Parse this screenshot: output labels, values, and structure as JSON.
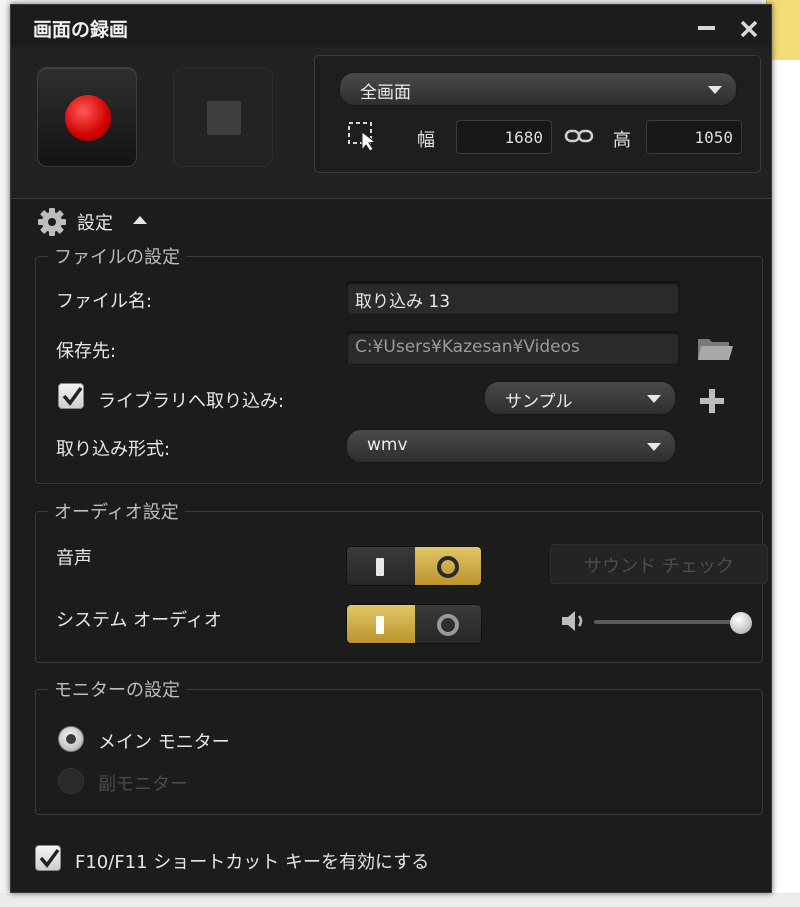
{
  "window": {
    "title": "画面の録画"
  },
  "capture": {
    "mode_selected": "全画面",
    "width_label": "幅",
    "width_value": "1680",
    "height_label": "高",
    "height_value": "1050"
  },
  "settings": {
    "header_label": "設定",
    "file_group": {
      "title": "ファイルの設定",
      "filename_label": "ファイル名:",
      "filename_value": "取り込み 13",
      "save_label": "保存先:",
      "save_value": "C:¥Users¥Kazesan¥Videos",
      "library_checkbox_label": "ライブラリへ取り込み:",
      "library_checked": true,
      "library_selected": "サンプル",
      "format_label": "取り込み形式:",
      "format_selected": "wmv"
    },
    "audio_group": {
      "title": "オーディオ設定",
      "voice_label": "音声",
      "voice_state": "off",
      "sound_check_label": "サウンド チェック",
      "system_audio_label": "システム オーディオ",
      "system_audio_state": "on",
      "volume_fraction": 1.0
    },
    "monitor_group": {
      "title": "モニターの設定",
      "main_monitor_label": "メイン モニター",
      "sub_monitor_label": "副モニター",
      "selected": "main"
    },
    "shortcut_label": "F10/F11 ショートカット キーを有効にする",
    "shortcut_checked": true
  },
  "colors": {
    "window_bg": "#1c1c1c",
    "accent_toggle": "#d9b654",
    "record_red": "#d00000"
  }
}
